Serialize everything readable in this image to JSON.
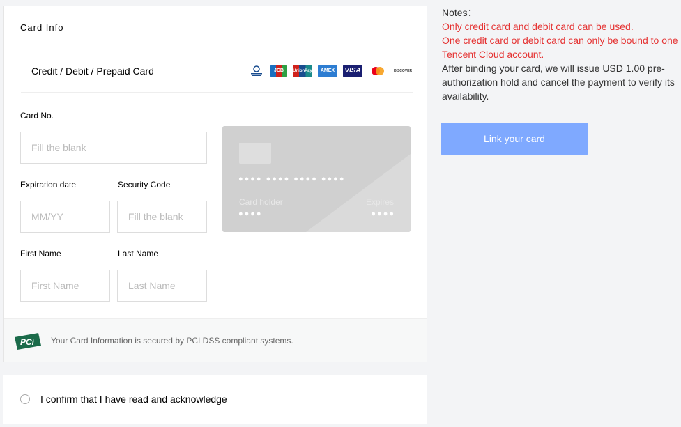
{
  "panel": {
    "header": "Card Info",
    "card_type_label": "Credit / Debit / Prepaid Card",
    "logos": [
      {
        "name": "diners-club-logo",
        "text": "Diners Club",
        "color": "#ffffff",
        "bg": "#ffffff"
      },
      {
        "name": "jcb-logo",
        "text": "JCB",
        "color": "#ffffff",
        "bg": "#1a6fbf"
      },
      {
        "name": "unionpay-logo",
        "text": "UnionPay",
        "color": "#ffffff",
        "bg": "#d0221c"
      },
      {
        "name": "amex-logo",
        "text": "AMEX",
        "color": "#ffffff",
        "bg": "#2d7dd2"
      },
      {
        "name": "visa-logo",
        "text": "VISA",
        "color": "#ffffff",
        "bg": "#1a1f71"
      },
      {
        "name": "mastercard-logo",
        "text": "",
        "color": "#ffffff",
        "bg": "#ffffff"
      },
      {
        "name": "discover-logo",
        "text": "DISCOVER",
        "color": "#333333",
        "bg": "#ffffff"
      }
    ],
    "card_no": {
      "label": "Card No.",
      "placeholder": "Fill the blank"
    },
    "expiration": {
      "label": "Expiration date",
      "placeholder": "MM/YY"
    },
    "security": {
      "label": "Security Code",
      "placeholder": "Fill the blank"
    },
    "first_name": {
      "label": "First Name",
      "placeholder": "First Name"
    },
    "last_name": {
      "label": "Last Name",
      "placeholder": "Last Name"
    },
    "card_preview": {
      "number_dots": "●●●● ●●●● ●●●● ●●●●",
      "holder_label": "Card holder",
      "holder_dots": "●●●●",
      "expires_label": "Expires",
      "expires_dots": "●●●●"
    },
    "pci_logo_text": "PCi",
    "pci_text": "Your Card Information is secured by PCI DSS compliant systems."
  },
  "confirm": {
    "text": "I confirm that I have read and acknowledge"
  },
  "notes": {
    "title": "Notes：",
    "line1": "Only credit card and debit card can be used.",
    "line2": "One credit card or debit card can only be bound to one Tencent Cloud account.",
    "line3": "After binding your card, we will issue USD 1.00 pre-authorization hold and cancel the payment to verify its availability."
  },
  "link_button": "Link your card",
  "colors": {
    "accent": "#7fa9ff",
    "warning": "#e53333",
    "pci_green": "#1b6b4a"
  }
}
